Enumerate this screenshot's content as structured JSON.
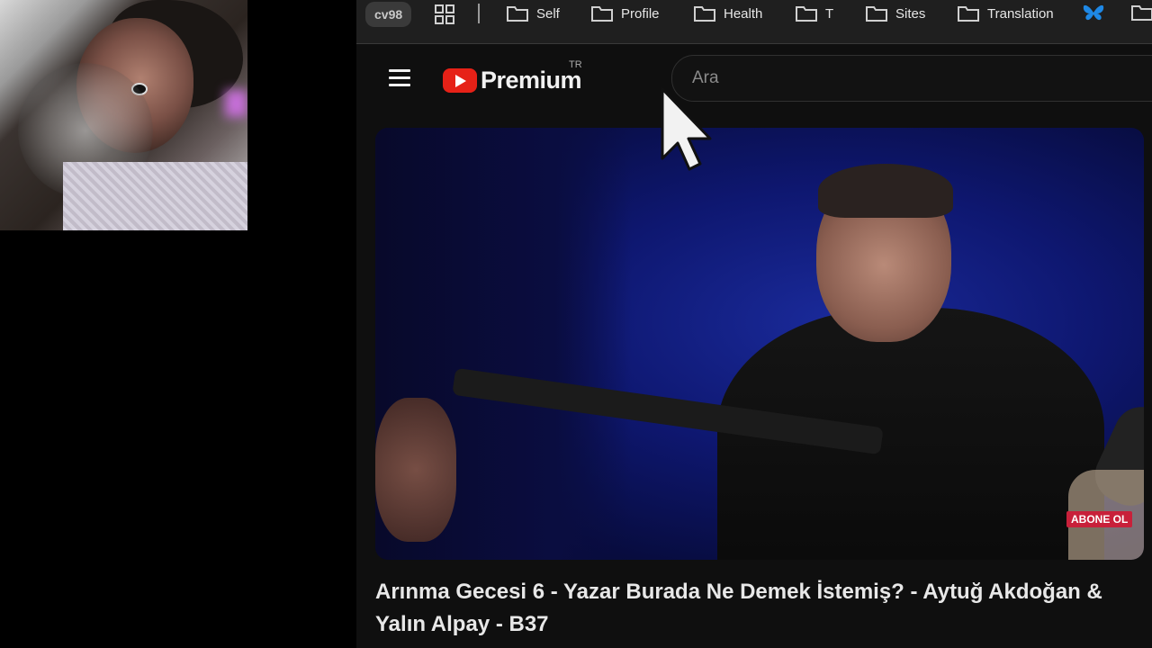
{
  "bookmarks_bar": {
    "profile_chip": "cv98",
    "folders": [
      {
        "label": "Self"
      },
      {
        "label": "Profile"
      },
      {
        "label": "Health"
      },
      {
        "label": "T"
      },
      {
        "label": "Sites"
      },
      {
        "label": "Translation"
      }
    ]
  },
  "header": {
    "logo_text": "Premium",
    "country_code": "TR",
    "search_placeholder": "Ara"
  },
  "video": {
    "subscribe_overlay": "ABONE OL",
    "title": "Arınma Gecesi 6 - Yazar Burada Ne Demek İstemiş? - Aytuğ Akdoğan & Yalın Alpay - B37"
  },
  "colors": {
    "youtube_red": "#e62117",
    "butterfly_blue": "#1e88e5",
    "subscribe_red": "#c8203a"
  }
}
